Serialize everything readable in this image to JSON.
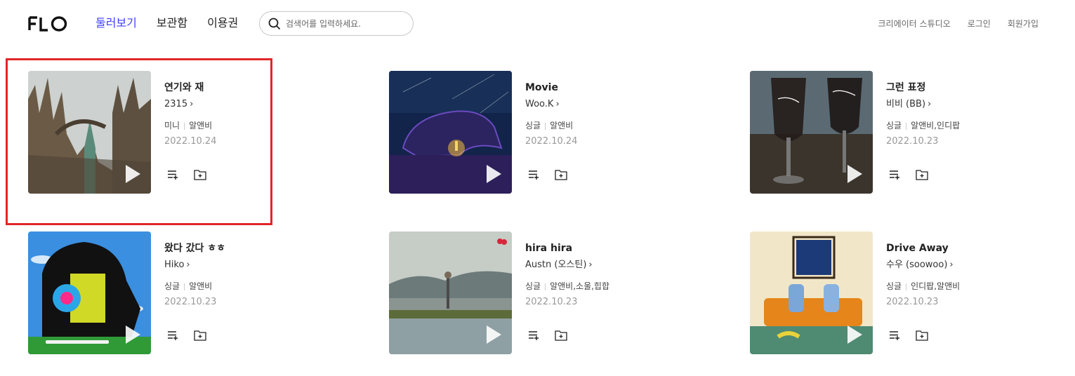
{
  "header": {
    "logo": "FLO",
    "nav": [
      {
        "label": "둘러보기",
        "active": true
      },
      {
        "label": "보관함",
        "active": false
      },
      {
        "label": "이용권",
        "active": false
      }
    ],
    "search": {
      "placeholder": "검색어를 입력하세요.",
      "value": ""
    },
    "util": [
      "크리에이터 스튜디오",
      "로그인",
      "회원가입"
    ]
  },
  "colors": {
    "accent": "#3f3fff",
    "highlight": "#e0262a"
  },
  "albums": [
    {
      "title": "연기와 재",
      "artist": "2315",
      "type": "미니",
      "genre": "알앤비",
      "date": "2022.10.24"
    },
    {
      "title": "Movie",
      "artist": "Woo.K",
      "type": "싱글",
      "genre": "알앤비",
      "date": "2022.10.24"
    },
    {
      "title": "그런 표정",
      "artist": "비비 (BB)",
      "type": "싱글",
      "genre": "알앤비,인디팝",
      "date": "2022.10.23"
    },
    {
      "title": "왔다 갔다 ㅎㅎ",
      "artist": "Hiko",
      "type": "싱글",
      "genre": "알앤비",
      "date": "2022.10.23"
    },
    {
      "title": "hira hira",
      "artist": "Austn (오스틴)",
      "type": "싱글",
      "genre": "알앤비,소울,힙합",
      "date": "2022.10.23"
    },
    {
      "title": "Drive Away",
      "artist": "수우 (soowoo)",
      "type": "싱글",
      "genre": "인디팝,알앤비",
      "date": "2022.10.23"
    }
  ],
  "icons": {
    "search": "search-icon",
    "play": "play-icon",
    "add_playlist": "add-to-playlist-icon",
    "add_folder": "add-to-folder-icon",
    "chevron": "chevron-right-icon"
  }
}
